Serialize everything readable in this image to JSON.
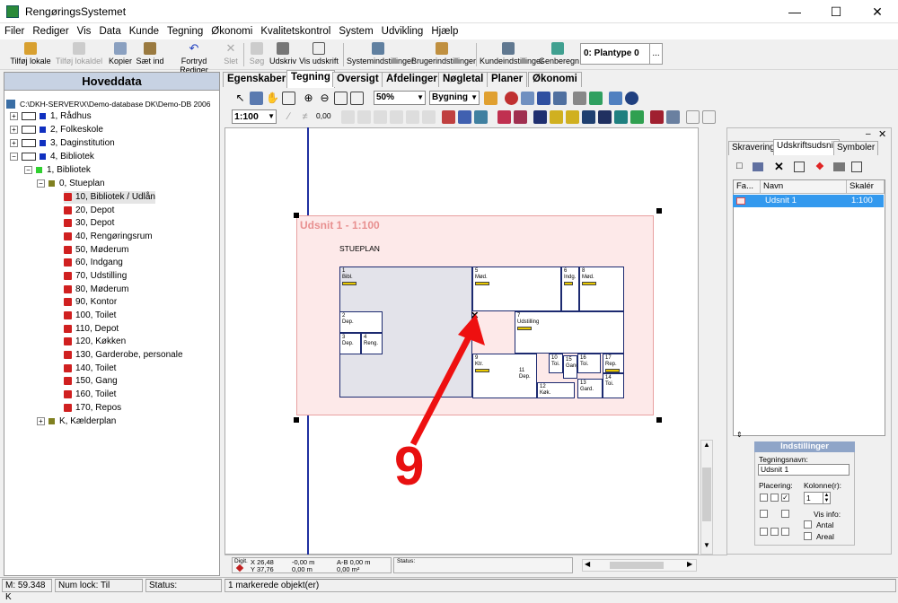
{
  "window": {
    "title": "RengøringsSystemet"
  },
  "menu": [
    "Filer",
    "Rediger",
    "Vis",
    "Data",
    "Kunde",
    "Tegning",
    "Økonomi",
    "Kvalitetskontrol",
    "System",
    "Udvikling",
    "Hjælp"
  ],
  "toolbar": {
    "buttons": [
      {
        "label": "Tilføj lokale",
        "enabled": true
      },
      {
        "label": "Tilføj lokaldel",
        "enabled": false
      },
      {
        "label": "Kopier",
        "enabled": true
      },
      {
        "label": "Sæt ind",
        "enabled": true
      },
      {
        "label": "Fortryd Rediger",
        "enabled": true
      },
      {
        "label": "Slet",
        "enabled": false
      },
      {
        "label": "Søg",
        "enabled": false
      },
      {
        "label": "Udskriv",
        "enabled": true
      },
      {
        "label": "Vis udskrift",
        "enabled": true
      },
      {
        "label": "Systemindstillinger",
        "enabled": true
      },
      {
        "label": "Brugerindstillinger",
        "enabled": true
      },
      {
        "label": "Kundeindstillinger",
        "enabled": true
      },
      {
        "label": "Genberegn",
        "enabled": true
      }
    ],
    "plantype": "0: Plantype 0"
  },
  "left": {
    "header": "Hoveddata",
    "root": "C:\\DKH-SERVER\\X\\Demo-database DK\\Demo-DB 2006",
    "buildings": [
      "1, Rådhus",
      "2, Folkeskole",
      "3, Daginstitution",
      "4, Bibliotek"
    ],
    "sub": "1, Bibliotek",
    "floor": "0, Stueplan",
    "rooms": [
      "10, Bibliotek / Udlån",
      "20, Depot",
      "30, Depot",
      "40, Rengøringsrum",
      "50, Møderum",
      "60, Indgang",
      "70, Udstilling",
      "80, Møderum",
      "90, Kontor",
      "100, Toilet",
      "110, Depot",
      "120, Køkken",
      "130, Garderobe, personale",
      "140, Toilet",
      "150, Gang",
      "160, Toilet",
      "170, Repos"
    ],
    "basement": "K, Kælderplan"
  },
  "tabs": [
    "Egenskaber",
    "Tegning",
    "Oversigt",
    "Afdelinger",
    "Nøgletal",
    "Planer",
    "Økonomi"
  ],
  "active_tab": "Tegning",
  "tb2": {
    "zoom": "50%",
    "layer": "Bygning"
  },
  "tb3": {
    "scale": "1:100",
    "value": "0,00"
  },
  "drawing": {
    "udsnit": "Udsnit 1 - 1:100",
    "floor_label": "STUEPLAN",
    "rooms": [
      {
        "no": "1",
        "name": "Bibl."
      },
      {
        "no": "5",
        "name": "Mød."
      },
      {
        "no": "6",
        "name": "Indg."
      },
      {
        "no": "8",
        "name": "Mød."
      },
      {
        "no": "2",
        "name": "Dep."
      },
      {
        "no": "7",
        "name": "Udstilling"
      },
      {
        "no": "3",
        "name": "Dep."
      },
      {
        "no": "4",
        "name": "Reng."
      },
      {
        "no": "9",
        "name": "Ktr."
      },
      {
        "no": "11",
        "name": "Dep."
      },
      {
        "no": "10",
        "name": "Toi."
      },
      {
        "no": "15",
        "name": "Gang"
      },
      {
        "no": "16",
        "name": "Toi."
      },
      {
        "no": "17",
        "name": "Rep."
      },
      {
        "no": "12",
        "name": "Køk."
      },
      {
        "no": "13",
        "name": "Gard."
      },
      {
        "no": "14",
        "name": "Toi."
      }
    ],
    "annotation": "9"
  },
  "right": {
    "tabs": [
      "Skravering",
      "Udskriftsudsnit",
      "Symboler"
    ],
    "active_tab": "Udskriftsudsnit",
    "columns": [
      "Fa...",
      "Navn",
      "Skalér"
    ],
    "rows": [
      {
        "navn": "Udsnit 1",
        "skaler": "1:100"
      }
    ],
    "settings": {
      "header": "Indstillinger",
      "tegningsnavn_label": "Tegningsnavn:",
      "tegningsnavn": "Udsnit 1",
      "placering_label": "Placering:",
      "kolonner_label": "Kolonne(r):",
      "kolonner": "1",
      "vis_info": "Vis info:",
      "antal": "Antal",
      "areal": "Areal"
    }
  },
  "coords": {
    "digit": "Digit.",
    "x": "X 26,48",
    "y": "Y 37,76",
    "dx": "-0,00 m",
    "dy": "0,00 m",
    "ab": "A-B 0,00 m",
    "area": "0,00 m²",
    "status": "Status:"
  },
  "statusbar": {
    "mem": "M: 59.348 K",
    "numlock": "Num lock: Til",
    "status": "Status:",
    "selected": "1 markerede objekt(er)"
  }
}
